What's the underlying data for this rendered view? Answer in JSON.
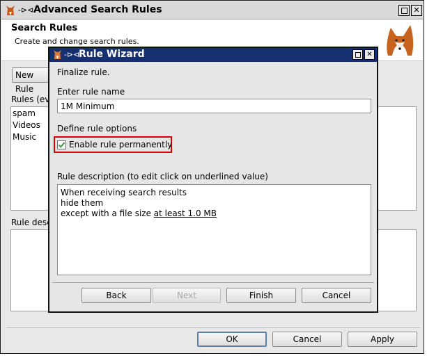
{
  "outer_window": {
    "title": "Advanced Search Rules",
    "header_title": "Search Rules",
    "header_subtitle": "Create and change search rules.",
    "new_rule_button": "New Rule",
    "rules_label": "Rules (eval",
    "rules": [
      "spam",
      "Videos",
      "Music"
    ],
    "rule_description_label": "Rule desc",
    "ok_button": "OK",
    "cancel_button": "Cancel",
    "apply_button": "Apply"
  },
  "wizard": {
    "title": "Rule Wizard",
    "step_text": "Finalize rule.",
    "rule_name_label": "Enter rule name",
    "rule_name_value": "1M Minimum",
    "options_label": "Define rule options",
    "enable_permanently_label": "Enable rule permanently",
    "enable_permanently_checked": true,
    "description_label": "Rule description (to edit click on underlined value)",
    "description_lines": {
      "line1": "When receiving search results",
      "line2": "hide them",
      "line3_prefix": "except with a file size ",
      "line3_link": "at least 1.0 MB"
    },
    "back_button": "Back",
    "next_button": "Next",
    "finish_button": "Finish",
    "cancel_button": "Cancel"
  },
  "colors": {
    "wizard_titlebar": "#152f70",
    "highlight_border": "#d40000",
    "check_green": "#3a9a3a"
  }
}
